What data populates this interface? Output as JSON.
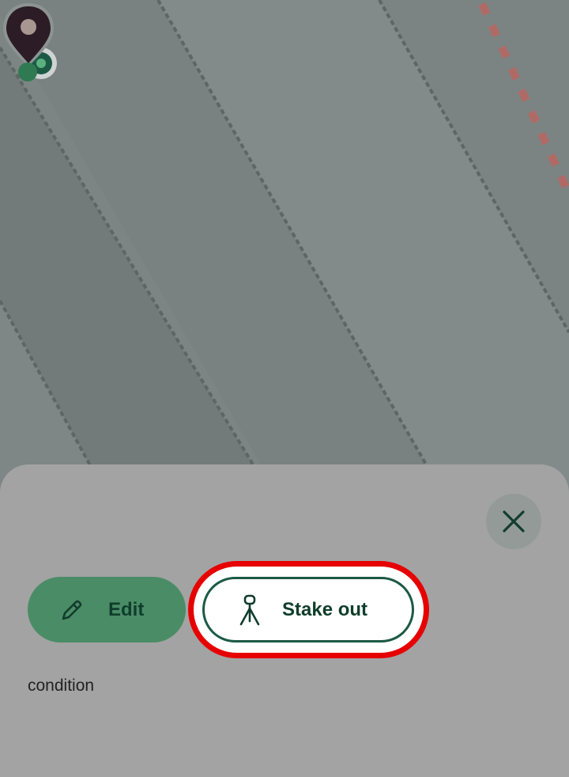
{
  "map": {
    "background": "#7d8584",
    "pin_color": "#2c1c26",
    "location_color": "#1c5a45"
  },
  "sheet": {
    "close_icon": "close-icon",
    "actions": {
      "edit_label": "Edit",
      "edit_icon": "pencil-icon",
      "stake_out_label": "Stake out",
      "stake_out_icon": "tripod-icon",
      "highlighted": "Stake out"
    },
    "field_label": "condition"
  },
  "colors": {
    "accent": "#4a8c66",
    "text_dark": "#0f3d2c",
    "highlight": "#e60000"
  }
}
